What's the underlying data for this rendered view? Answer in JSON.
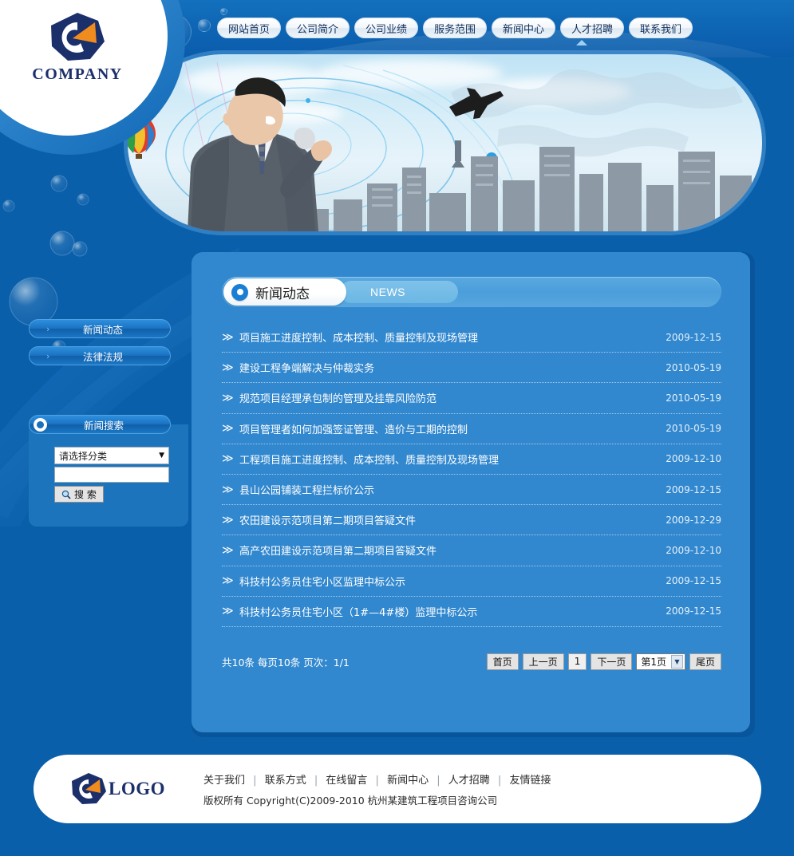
{
  "brand": {
    "name": "COMPANY",
    "footer_name": "LOGO"
  },
  "nav": {
    "items": [
      {
        "label": "网站首页"
      },
      {
        "label": "公司简介"
      },
      {
        "label": "公司业绩"
      },
      {
        "label": "服务范围"
      },
      {
        "label": "新闻中心"
      },
      {
        "label": "人才招聘"
      },
      {
        "label": "联系我们"
      }
    ]
  },
  "sidebar": {
    "items": [
      {
        "label": "新闻动态",
        "chevron": "›"
      },
      {
        "label": "法律法规",
        "chevron": "›"
      }
    ],
    "search": {
      "title": "新闻搜索",
      "category_value": "请选择分类",
      "keyword_value": "",
      "keyword_placeholder": "",
      "button_label": "搜 索",
      "arrow": "▼"
    }
  },
  "main": {
    "section": {
      "title": "新闻动态",
      "subtitle": "NEWS"
    },
    "news": [
      {
        "arrow": "≫",
        "title": "项目施工进度控制、成本控制、质量控制及现场管理",
        "date": "2009-12-15"
      },
      {
        "arrow": "≫",
        "title": "建设工程争端解决与仲裁实务",
        "date": "2010-05-19"
      },
      {
        "arrow": "≫",
        "title": "规范项目经理承包制的管理及挂靠风险防范",
        "date": "2010-05-19"
      },
      {
        "arrow": "≫",
        "title": "项目管理者如何加强签证管理、造价与工期的控制",
        "date": "2010-05-19"
      },
      {
        "arrow": "≫",
        "title": "工程项目施工进度控制、成本控制、质量控制及现场管理",
        "date": "2009-12-10"
      },
      {
        "arrow": "≫",
        "title": "县山公园铺装工程拦标价公示",
        "date": "2009-12-15"
      },
      {
        "arrow": "≫",
        "title": "农田建设示范项目第二期项目答疑文件",
        "date": "2009-12-29"
      },
      {
        "arrow": "≫",
        "title": "高产农田建设示范项目第二期项目答疑文件",
        "date": "2009-12-10"
      },
      {
        "arrow": "≫",
        "title": "科技村公务员住宅小区监理中标公示",
        "date": "2009-12-15"
      },
      {
        "arrow": "≫",
        "title": "科技村公务员住宅小区（1#—4#楼）监理中标公示",
        "date": "2009-12-15"
      }
    ],
    "pager": {
      "info": "共10条 每页10条 页次：1/1",
      "first": "首页",
      "prev": "上一页",
      "current": "1",
      "next": "下一页",
      "select_value": "第1页",
      "select_arrow": "▼",
      "last": "尾页"
    }
  },
  "footer": {
    "links": [
      {
        "label": "关于我们"
      },
      {
        "label": "联系方式"
      },
      {
        "label": "在线留言"
      },
      {
        "label": "新闻中心"
      },
      {
        "label": "人才招聘"
      },
      {
        "label": "友情链接"
      }
    ],
    "separator": "|",
    "copyright": "版权所有  Copyright(C)2009-2010 杭州某建筑工程项目咨询公司"
  },
  "colors": {
    "page_bg": "#0a5fab",
    "panel_bg": "#3288cf",
    "accent_white": "#ffffff",
    "logo_navy": "#1b2f6b",
    "logo_orange": "#f08c1e"
  }
}
